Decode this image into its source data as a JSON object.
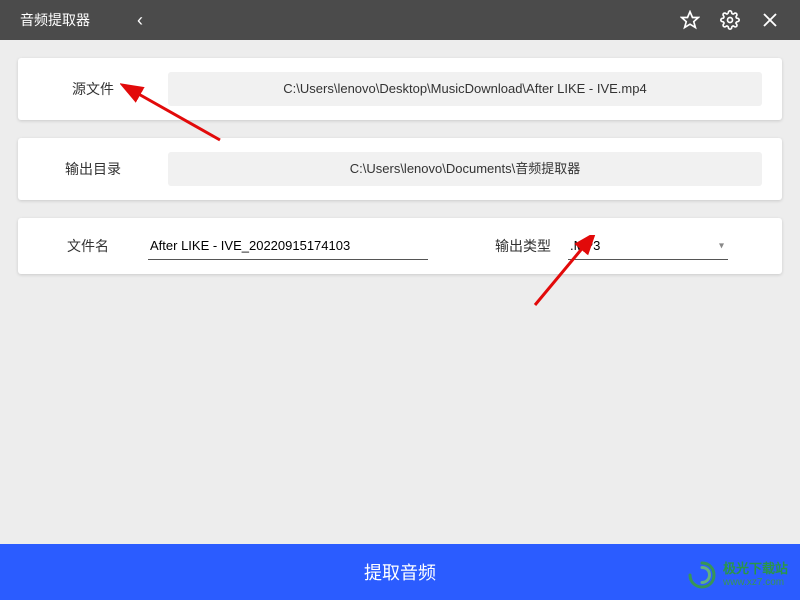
{
  "titlebar": {
    "title": "音频提取器",
    "back_glyph": "‹"
  },
  "row_source": {
    "label": "源文件",
    "value": "C:\\Users\\lenovo\\Desktop\\MusicDownload\\After LIKE - IVE.mp4"
  },
  "row_output": {
    "label": "输出目录",
    "value": "C:\\Users\\lenovo\\Documents\\音频提取器"
  },
  "row_name": {
    "label": "文件名",
    "value": "After LIKE - IVE_20220915174103",
    "type_label": "输出类型",
    "type_value": ".MP3"
  },
  "extract_label": "提取音频",
  "watermark": {
    "line1": "极光下载站",
    "line2": "www.xz7.com"
  }
}
